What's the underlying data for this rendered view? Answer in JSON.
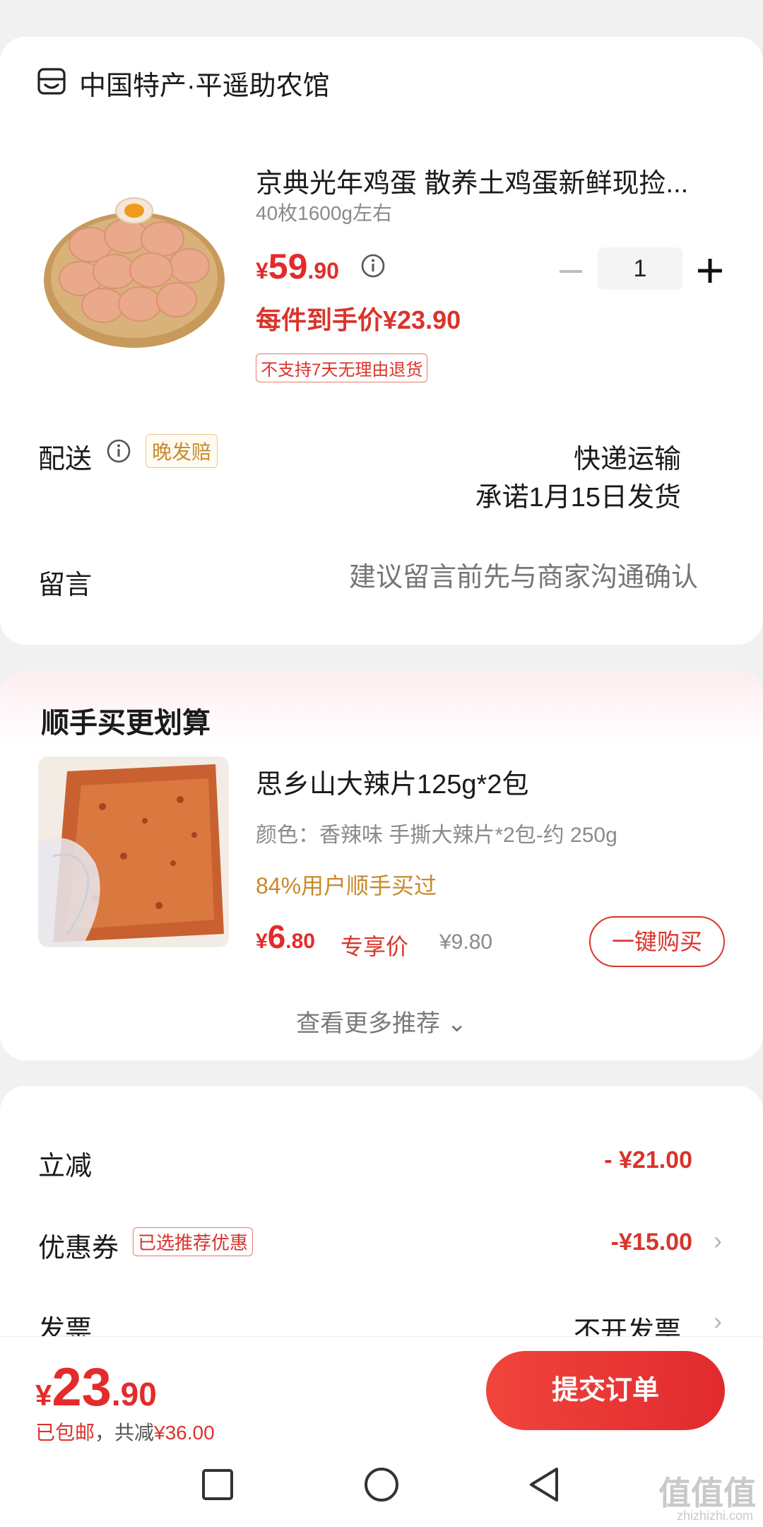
{
  "shop": {
    "name": "中国特产·平遥助农馆",
    "icon": "shop-icon"
  },
  "product": {
    "title": "京典光年鸡蛋 散养土鸡蛋新鲜现捡...",
    "spec": "40枚1600g左右",
    "price_currency": "¥",
    "price_int": "59",
    "price_dec": ".90",
    "quantity": "1",
    "per_item_price": "每件到手价¥23.90",
    "return_policy": "不支持7天无理由退货"
  },
  "delivery": {
    "label": "配送",
    "late_tag": "晚发赔",
    "method": "快递运输",
    "promise": "承诺1月15日发货"
  },
  "message": {
    "label": "留言",
    "placeholder": "建议留言前先与商家沟通确认"
  },
  "recommend": {
    "title": "顺手买更划算",
    "item": {
      "name": "思乡山大辣片125g*2包",
      "spec": "颜色：香辣味 手撕大辣片*2包-约 250g",
      "social": "84%用户顺手买过",
      "price_currency": "¥",
      "price_int": "6",
      "price_dec": ".80",
      "exclusive_label": "专享价",
      "original_price": "¥9.80",
      "buy_label": "一键购买"
    },
    "more_label": "查看更多推荐 ⌄"
  },
  "summary": {
    "discount_label": "立减",
    "discount_value": "- ¥21.00",
    "coupon_label": "优惠券",
    "coupon_tag": "已选推荐优惠",
    "coupon_value": "-¥15.00",
    "invoice_label": "发票",
    "invoice_value": "不开发票"
  },
  "footer": {
    "total_currency": "¥",
    "total_int": "23",
    "total_dec": ".90",
    "shipping_note": "已包邮",
    "saved_prefix": "，共减",
    "saved_amount": "¥36.00",
    "submit_label": "提交订单"
  },
  "watermark": {
    "text": "值值值",
    "sub": "zhizhizhi.com"
  },
  "colors": {
    "accent": "#e32b2b",
    "gold": "#c9892b",
    "gray": "#8a8a8a"
  }
}
